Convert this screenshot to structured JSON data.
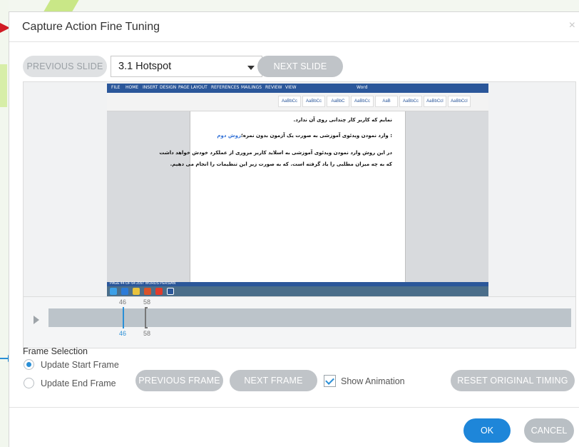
{
  "dialog": {
    "title": "Capture Action Fine Tuning",
    "close_glyph": "×"
  },
  "slide_nav": {
    "previous_label": "PREVIOUS SLIDE",
    "selected_slide": "3.1 Hotspot",
    "next_label": "NEXT SLIDE"
  },
  "preview": {
    "window_title": "Word",
    "ribbon_tabs": [
      "FILE",
      "HOME",
      "INSERT",
      "DESIGN",
      "PAGE LAYOUT",
      "REFERENCES",
      "MAILINGS",
      "REVIEW",
      "VIEW"
    ],
    "styles": [
      "AaBbCc",
      "AaBbCc",
      "AaBbC",
      "AaBbCc",
      "AaB",
      "AaBbCc",
      "AaBbCcI",
      "AaBbCcI",
      "AaBbCcI",
      "AaBbCcI"
    ],
    "document_lines": [
      {
        "text": "نمایم که کاربر کار چندانی روی آن ندارد.",
        "highlight": ""
      },
      {
        "text": ": وارد نمودن ویدئوی آموزشی به صورت یک آزمون بدون نمره؛",
        "highlight": "روش دوم"
      },
      {
        "text": "در این روش وارد نمودن ویدئوی آموزشی به اسلاید کاربر مروری از عملکرد خودش خواهد داشت",
        "highlight": ""
      },
      {
        "text": "که به چه میزان مطلبی را یاد گرفته است. که به صورت زیر این تنظیمات را انجام می دهیم.",
        "highlight": ""
      }
    ],
    "status_text": "PAGE 44 OF 64   2097 WORDS   PERSIAN"
  },
  "timeline": {
    "start_frame_top": "46",
    "end_frame_top": "58",
    "start_frame_bottom": "46",
    "end_frame_bottom": "58"
  },
  "frame_selection": {
    "heading": "Frame Selection",
    "option_start": "Update Start Frame",
    "option_end": "Update End Frame",
    "selected": "Update Start Frame"
  },
  "frame_buttons": {
    "previous_label": "PREVIOUS FRAME",
    "next_label": "NEXT FRAME",
    "show_animation_label": "Show Animation",
    "show_animation_checked": true,
    "reset_label": "RESET ORIGINAL TIMING"
  },
  "footer": {
    "ok_label": "OK",
    "cancel_label": "CANCEL"
  },
  "colors": {
    "accent": "#1e86d9",
    "button_gray": "#c0c4c8",
    "annotation_red": "#d01b24",
    "annotation_blue": "#2a8fd6"
  }
}
